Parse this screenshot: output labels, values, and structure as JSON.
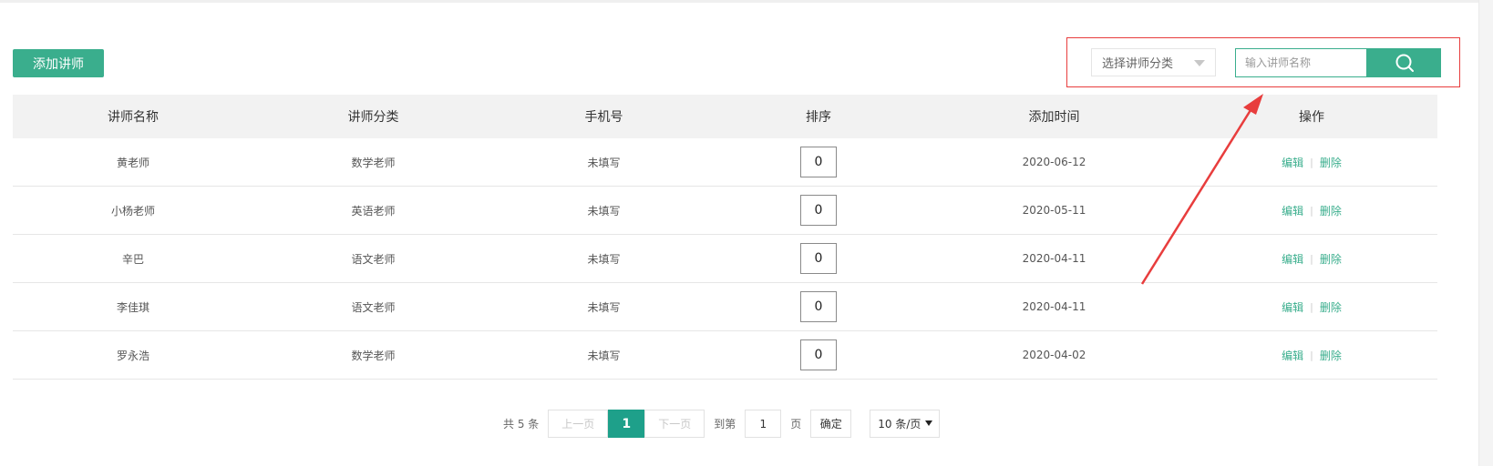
{
  "toolbar": {
    "add_label": "添加讲师"
  },
  "search": {
    "category_selected": "选择讲师分类",
    "name_placeholder": "输入讲师名称",
    "icon": "search-icon"
  },
  "table": {
    "headers": [
      "讲师名称",
      "讲师分类",
      "手机号",
      "排序",
      "添加时间",
      "操作"
    ],
    "rows": [
      {
        "name": "黄老师",
        "category": "数学老师",
        "phone": "未填写",
        "sort": "0",
        "date": "2020-06-12"
      },
      {
        "name": "小杨老师",
        "category": "英语老师",
        "phone": "未填写",
        "sort": "0",
        "date": "2020-05-11"
      },
      {
        "name": "辛巴",
        "category": "语文老师",
        "phone": "未填写",
        "sort": "0",
        "date": "2020-04-11"
      },
      {
        "name": "李佳琪",
        "category": "语文老师",
        "phone": "未填写",
        "sort": "0",
        "date": "2020-04-11"
      },
      {
        "name": "罗永浩",
        "category": "数学老师",
        "phone": "未填写",
        "sort": "0",
        "date": "2020-04-02"
      }
    ],
    "edit_label": "编辑",
    "separator": "|",
    "delete_label": "删除"
  },
  "pagination": {
    "total_text": "共 5 条",
    "prev_label": "上一页",
    "current_page": "1",
    "next_label": "下一页",
    "goto_label": "到第",
    "goto_value": "1",
    "page_unit": "页",
    "confirm_label": "确定",
    "page_size_label": "10 条/页"
  },
  "colors": {
    "accent": "#3aae8d",
    "active_page": "#1ea08a",
    "annotation": "#e83d3d"
  }
}
